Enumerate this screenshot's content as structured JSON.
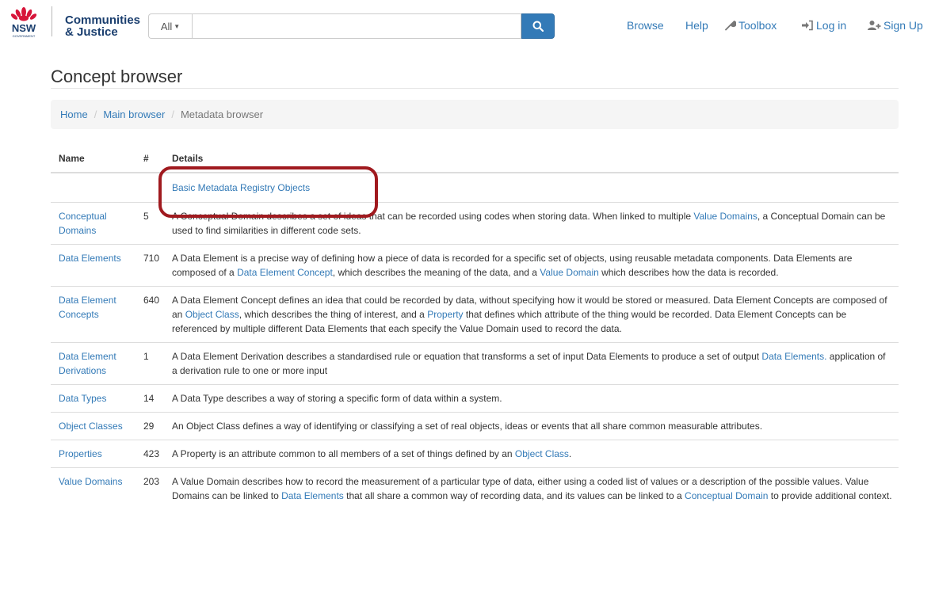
{
  "brand": {
    "logo_text": "NSW",
    "logo_subtext": "GOVERNMENT",
    "line1": "Communities",
    "line2": "& Justice"
  },
  "search": {
    "dropdown_label": "All",
    "placeholder": "",
    "button_icon": "search-icon"
  },
  "nav": {
    "browse": "Browse",
    "help": "Help",
    "toolbox": "Toolbox",
    "login": "Log in",
    "signup": "Sign Up"
  },
  "page": {
    "title": "Concept browser"
  },
  "breadcrumb": {
    "items": [
      "Home",
      "Main browser",
      "Metadata browser"
    ]
  },
  "table": {
    "headers": {
      "name": "Name",
      "count": "#",
      "details": "Details"
    },
    "group_label": "Basic Metadata Registry Objects",
    "rows": [
      {
        "name": "Conceptual Domains",
        "count": "5",
        "details": [
          {
            "t": "A Conceptual Domain describes a set of ideas that can be recorded using codes when storing data. When linked to multiple "
          },
          {
            "t": "Value Domains",
            "link": true
          },
          {
            "t": ", a Conceptual Domain can be used to find similarities in different code sets."
          }
        ]
      },
      {
        "name": "Data Elements",
        "count": "710",
        "details": [
          {
            "t": "A Data Element is a precise way of defining how a piece of data is recorded for a specific set of objects, using reusable metadata components. Data Elements are composed of a "
          },
          {
            "t": "Data Element Concept",
            "link": true
          },
          {
            "t": ", which describes the meaning of the data, and a "
          },
          {
            "t": "Value Domain",
            "link": true
          },
          {
            "t": " which describes how the data is recorded."
          }
        ]
      },
      {
        "name": "Data Element Concepts",
        "count": "640",
        "details": [
          {
            "t": "A Data Element Concept defines an idea that could be recorded by data, without specifying how it would be stored or measured. Data Element Concepts are composed of an "
          },
          {
            "t": "Object Class",
            "link": true
          },
          {
            "t": ", which describes the thing of interest, and a "
          },
          {
            "t": "Property",
            "link": true
          },
          {
            "t": " that defines which attribute of the thing would be recorded. Data Element Concepts can be referenced by multiple different Data Elements that each specify the Value Domain used to record the data."
          }
        ]
      },
      {
        "name": "Data Element Derivations",
        "count": "1",
        "details": [
          {
            "t": "A Data Element Derivation describes a standardised rule or equation that transforms a set of input Data Elements to produce a set of output "
          },
          {
            "t": "Data Elements.",
            "link": true
          },
          {
            "t": " application of a derivation rule to one or more input"
          }
        ]
      },
      {
        "name": "Data Types",
        "count": "14",
        "details": [
          {
            "t": "A Data Type describes a way of storing a specific form of data within a system."
          }
        ]
      },
      {
        "name": "Object Classes",
        "count": "29",
        "details": [
          {
            "t": "An Object Class defines a way of identifying or classifying a set of real objects, ideas or events that all share common measurable attributes."
          }
        ]
      },
      {
        "name": "Properties",
        "count": "423",
        "details": [
          {
            "t": "A Property is an attribute common to all members of a set of things defined by an "
          },
          {
            "t": "Object Class",
            "link": true
          },
          {
            "t": "."
          }
        ]
      },
      {
        "name": "Value Domains",
        "count": "203",
        "details": [
          {
            "t": "A Value Domain describes how to record the measurement of a particular type of data, either using a coded list of values or a description of the possible values. Value Domains can be linked to "
          },
          {
            "t": "Data Elements",
            "link": true
          },
          {
            "t": " that all share a common way of recording data, and its values can be linked to a "
          },
          {
            "t": "Conceptual Domain",
            "link": true
          },
          {
            "t": " to provide additional context."
          }
        ]
      }
    ]
  },
  "colors": {
    "link": "#337ab7",
    "primary_button": "#337ab7",
    "highlight_box": "#a01a1f",
    "brand_navy": "#1a3e6e",
    "waratah_red": "#d7153a"
  }
}
